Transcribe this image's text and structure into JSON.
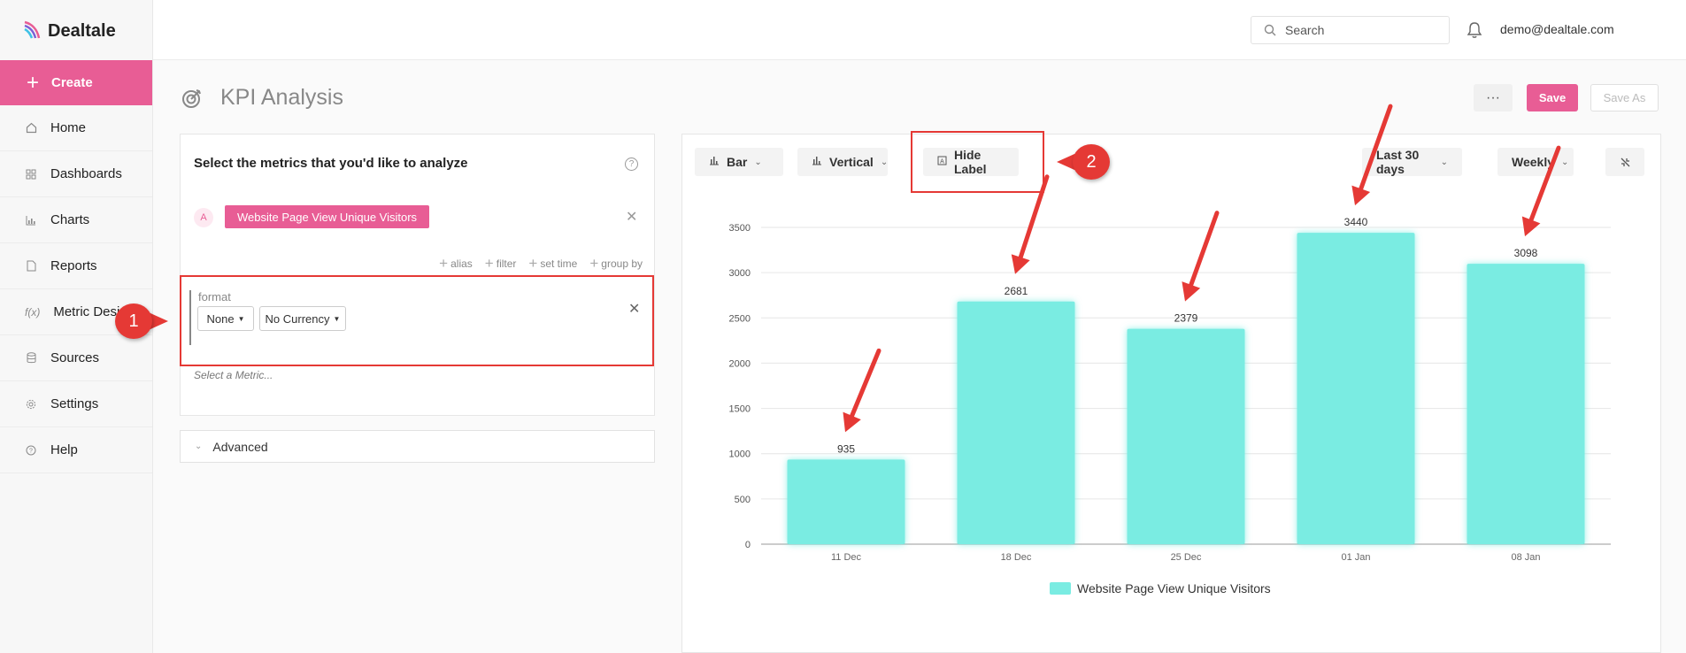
{
  "app": {
    "name": "Dealtale"
  },
  "sidebar": {
    "create_label": "Create",
    "items": [
      {
        "label": "Home",
        "icon": "home-icon"
      },
      {
        "label": "Dashboards",
        "icon": "grid-icon"
      },
      {
        "label": "Charts",
        "icon": "chart-icon"
      },
      {
        "label": "Reports",
        "icon": "document-icon"
      },
      {
        "label": "Metric Designer",
        "icon": "function-icon"
      },
      {
        "label": "Sources",
        "icon": "database-icon"
      },
      {
        "label": "Settings",
        "icon": "gear-icon"
      },
      {
        "label": "Help",
        "icon": "help-icon"
      }
    ]
  },
  "topbar": {
    "search_placeholder": "Search",
    "user_email": "demo@dealtale.com"
  },
  "header": {
    "title": "KPI Analysis",
    "more_label": "···",
    "save_label": "Save",
    "save_as_label": "Save As"
  },
  "metrics_panel": {
    "title": "Select the metrics that you'd like to analyze",
    "metric_letter": "A",
    "metric_name": "Website Page View Unique Visitors",
    "options": [
      "alias",
      "filter",
      "set time",
      "group by"
    ],
    "format_label": "format",
    "format_value": "None",
    "currency_value": "No Currency",
    "select_placeholder": "Select a Metric...",
    "advanced_label": "Advanced"
  },
  "chart_toolbar": {
    "type_label": "Bar",
    "orientation_label": "Vertical",
    "hide_label": "Hide Label",
    "range_label": "Last 30 days",
    "interval_label": "Weekly"
  },
  "callouts": [
    "1",
    "2"
  ],
  "colors": {
    "accent": "#e85d95",
    "bar": "#7aece2",
    "callout": "#e53935"
  },
  "chart_data": {
    "type": "bar",
    "categories": [
      "11 Dec",
      "18 Dec",
      "25 Dec",
      "01 Jan",
      "08 Jan"
    ],
    "series": [
      {
        "name": "Website Page View Unique Visitors",
        "values": [
          935,
          2681,
          2379,
          3440,
          3098
        ]
      }
    ],
    "yticks": [
      "0",
      "500",
      "1000",
      "1500",
      "2000",
      "2500",
      "3000",
      "3500"
    ],
    "ylim": [
      0,
      3500
    ],
    "grid": true,
    "legend": "bottom",
    "data_labels": true
  }
}
